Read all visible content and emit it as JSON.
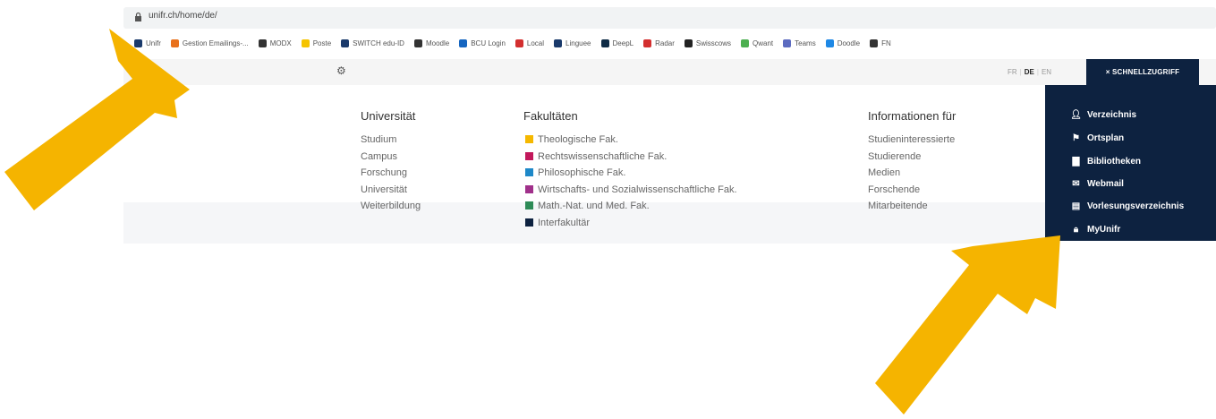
{
  "browser": {
    "url": "unifr.ch/home/de/",
    "bookmarks": [
      {
        "label": "Unifr",
        "color": "#1a3a6b",
        "icon": "unifr-icon"
      },
      {
        "label": "Gestion Emailings-...",
        "color": "#e8711c",
        "icon": "chevron-right-icon"
      },
      {
        "label": "MODX",
        "color": "#333333",
        "icon": "modx-icon"
      },
      {
        "label": "Poste",
        "color": "#f5c400",
        "icon": "poste-icon"
      },
      {
        "label": "SWITCH edu-ID",
        "color": "#1a3a6b",
        "icon": "cloud-icon"
      },
      {
        "label": "Moodle",
        "color": "#333333",
        "icon": "moodle-icon"
      },
      {
        "label": "BCU Login",
        "color": "#1565c0",
        "icon": "bcu-icon"
      },
      {
        "label": "Local",
        "color": "#d32f2f",
        "icon": "local-icon"
      },
      {
        "label": "Linguee",
        "color": "#1a3a6b",
        "icon": "linguee-icon"
      },
      {
        "label": "DeepL",
        "color": "#0f2b46",
        "icon": "deepl-icon"
      },
      {
        "label": "Radar",
        "color": "#d32f2f",
        "icon": "shield-icon"
      },
      {
        "label": "Swisscows",
        "color": "#222222",
        "icon": "swisscows-icon"
      },
      {
        "label": "Qwant",
        "color": "#4caf50",
        "icon": "qwant-icon"
      },
      {
        "label": "Teams",
        "color": "#5c6bc0",
        "icon": "teams-icon"
      },
      {
        "label": "Doodle",
        "color": "#1e88e5",
        "icon": "doodle-icon"
      },
      {
        "label": "FN",
        "color": "#333333",
        "icon": "fn-icon"
      }
    ]
  },
  "header": {
    "languages": [
      "FR",
      "DE",
      "EN"
    ],
    "active_language": "DE",
    "quick_access_label": "× SCHNELLZUGRIFF"
  },
  "menu": {
    "universitaet": {
      "title": "Universität",
      "items": [
        "Studium",
        "Campus",
        "Forschung",
        "Universität",
        "Weiterbildung"
      ]
    },
    "fakultaeten": {
      "title": "Fakultäten",
      "items": [
        {
          "label": "Theologische Fak.",
          "color": "#f5b800"
        },
        {
          "label": "Rechtswissenschaftliche Fak.",
          "color": "#c2185b"
        },
        {
          "label": "Philosophische Fak.",
          "color": "#1e88c8"
        },
        {
          "label": "Wirtschafts- und Sozialwissenschaftliche Fak.",
          "color": "#a0308a"
        },
        {
          "label": "Math.-Nat. und Med. Fak.",
          "color": "#2e8b57"
        },
        {
          "label": "Interfakultär",
          "color": "#0d2240"
        }
      ]
    },
    "informationen": {
      "title": "Informationen für",
      "items": [
        "Studieninteressierte",
        "Studierende",
        "Medien",
        "Forschende",
        "Mitarbeitende"
      ]
    }
  },
  "quick_access": {
    "items": [
      {
        "label": "Verzeichnis",
        "icon": "person-icon"
      },
      {
        "label": "Ortsplan",
        "icon": "map-pin-icon"
      },
      {
        "label": "Bibliotheken",
        "icon": "book-icon"
      },
      {
        "label": "Webmail",
        "icon": "mail-icon"
      },
      {
        "label": "Vorlesungsverzeichnis",
        "icon": "list-icon"
      },
      {
        "label": "MyUnifr",
        "icon": "lock-icon"
      }
    ]
  },
  "colors": {
    "navy": "#0d2240",
    "arrow": "#f5b400"
  }
}
